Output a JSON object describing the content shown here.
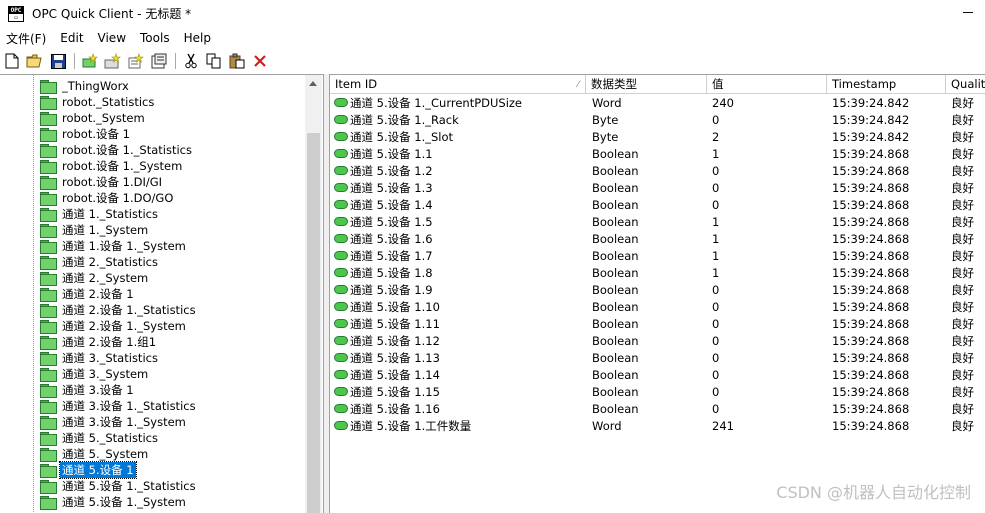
{
  "window": {
    "title": "OPC Quick Client - 无标题 *"
  },
  "menu": [
    "文件(F)",
    "Edit",
    "View",
    "Tools",
    "Help"
  ],
  "toolbar": {
    "buttons": [
      "new-file-icon",
      "open-folder-icon",
      "save-icon",
      "new-server-icon",
      "new-group-icon",
      "new-item-icon",
      "properties-icon",
      "cut-icon",
      "copy-icon",
      "paste-icon",
      "delete-icon"
    ]
  },
  "tree": {
    "items": [
      "_ThingWorx",
      "robot._Statistics",
      "robot._System",
      "robot.设备 1",
      "robot.设备 1._Statistics",
      "robot.设备 1._System",
      "robot.设备 1.DI/GI",
      "robot.设备 1.DO/GO",
      "通道 1._Statistics",
      "通道 1._System",
      "通道 1.设备 1._System",
      "通道 2._Statistics",
      "通道 2._System",
      "通道 2.设备 1",
      "通道 2.设备 1._Statistics",
      "通道 2.设备 1._System",
      "通道 2.设备 1.组1",
      "通道 3._Statistics",
      "通道 3._System",
      "通道 3.设备 1",
      "通道 3.设备 1._Statistics",
      "通道 3.设备 1._System",
      "通道 5._Statistics",
      "通道 5._System",
      "通道 5.设备 1",
      "通道 5.设备 1._Statistics",
      "通道 5.设备 1._System"
    ],
    "selected_index": 24
  },
  "table": {
    "columns": [
      "Item ID",
      "数据类型",
      "值",
      "Timestamp",
      "Quality"
    ],
    "rows": [
      [
        "通道 5.设备 1._CurrentPDUSize",
        "Word",
        "240",
        "15:39:24.842",
        "良好"
      ],
      [
        "通道 5.设备 1._Rack",
        "Byte",
        "0",
        "15:39:24.842",
        "良好"
      ],
      [
        "通道 5.设备 1._Slot",
        "Byte",
        "2",
        "15:39:24.842",
        "良好"
      ],
      [
        "通道 5.设备 1.1",
        "Boolean",
        "1",
        "15:39:24.868",
        "良好"
      ],
      [
        "通道 5.设备 1.2",
        "Boolean",
        "0",
        "15:39:24.868",
        "良好"
      ],
      [
        "通道 5.设备 1.3",
        "Boolean",
        "0",
        "15:39:24.868",
        "良好"
      ],
      [
        "通道 5.设备 1.4",
        "Boolean",
        "0",
        "15:39:24.868",
        "良好"
      ],
      [
        "通道 5.设备 1.5",
        "Boolean",
        "1",
        "15:39:24.868",
        "良好"
      ],
      [
        "通道 5.设备 1.6",
        "Boolean",
        "1",
        "15:39:24.868",
        "良好"
      ],
      [
        "通道 5.设备 1.7",
        "Boolean",
        "1",
        "15:39:24.868",
        "良好"
      ],
      [
        "通道 5.设备 1.8",
        "Boolean",
        "1",
        "15:39:24.868",
        "良好"
      ],
      [
        "通道 5.设备 1.9",
        "Boolean",
        "0",
        "15:39:24.868",
        "良好"
      ],
      [
        "通道 5.设备 1.10",
        "Boolean",
        "0",
        "15:39:24.868",
        "良好"
      ],
      [
        "通道 5.设备 1.11",
        "Boolean",
        "0",
        "15:39:24.868",
        "良好"
      ],
      [
        "通道 5.设备 1.12",
        "Boolean",
        "0",
        "15:39:24.868",
        "良好"
      ],
      [
        "通道 5.设备 1.13",
        "Boolean",
        "0",
        "15:39:24.868",
        "良好"
      ],
      [
        "通道 5.设备 1.14",
        "Boolean",
        "0",
        "15:39:24.868",
        "良好"
      ],
      [
        "通道 5.设备 1.15",
        "Boolean",
        "0",
        "15:39:24.868",
        "良好"
      ],
      [
        "通道 5.设备 1.16",
        "Boolean",
        "0",
        "15:39:24.868",
        "良好"
      ],
      [
        "通道 5.设备 1.工件数量",
        "Word",
        "241",
        "15:39:24.868",
        "良好"
      ]
    ]
  },
  "watermark": "CSDN @机器人自动化控制"
}
